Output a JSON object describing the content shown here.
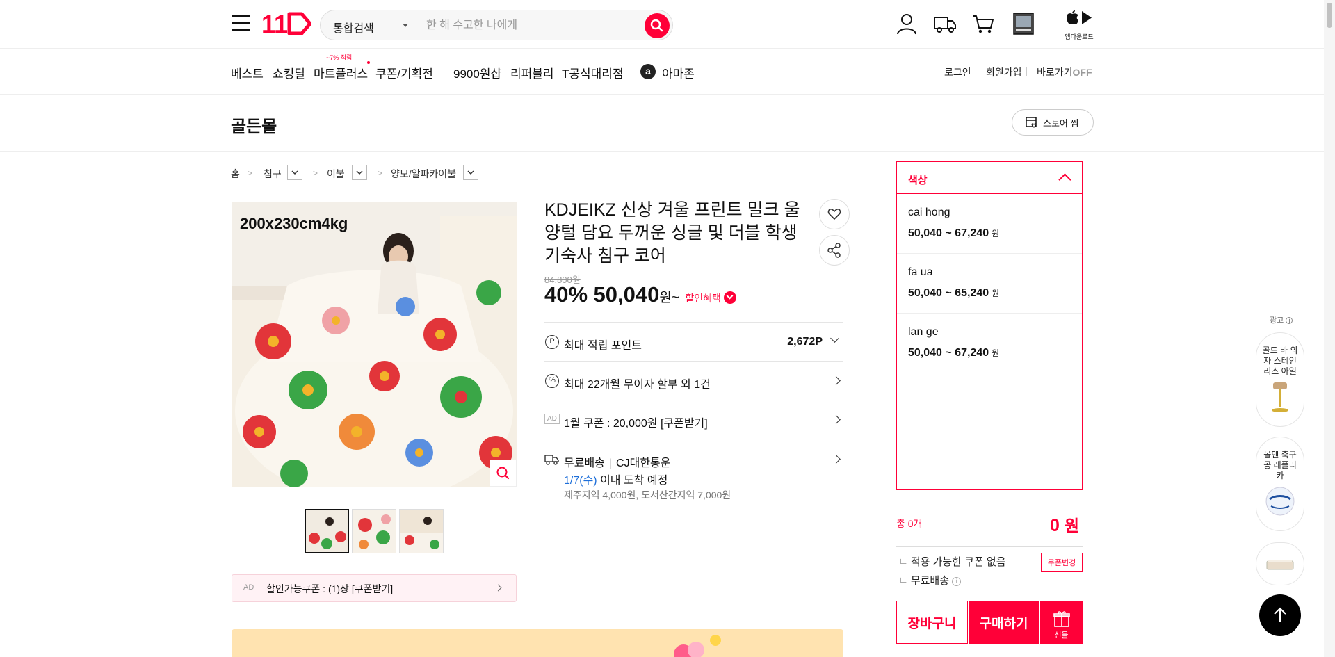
{
  "header": {
    "search_category": "통합검색",
    "search_placeholder": "한 해 수고한 나에게",
    "app_download_label": "앱다운로드",
    "icons": [
      "menu-icon",
      "user-icon",
      "delivery-truck-icon",
      "cart-icon",
      "recent-view-icon",
      "app-store-icon",
      "play-store-icon",
      "search-icon"
    ]
  },
  "nav": {
    "items": [
      "베스트",
      "쇼킹딜",
      "마트플러스",
      "쿠폰/기획전",
      "9900원샵",
      "리퍼블리",
      "T공식대리점",
      "아마존"
    ],
    "mart_badge": "~7% 적립",
    "util_links": [
      "로그인",
      "회원가입",
      "바로가기"
    ],
    "shortcut_state": "OFF"
  },
  "store": {
    "name": "골든몰",
    "fav_button": "스토어 찜"
  },
  "breadcrumb": [
    "홈",
    "침구",
    "이불",
    "양모/알파카이불"
  ],
  "product": {
    "image_text": "200x230cm4kg",
    "title": "KDJEIKZ 신상 겨울 프린트 밀크 울 양털 담요 두꺼운 싱글 및 더블 학생 기숙사 침구 코어",
    "original_price": "84,800원",
    "discount": "40%",
    "price": "50,040",
    "price_unit": "원~",
    "discount_benefit": "할인혜택",
    "points_label": "최대 적립 포인트",
    "points_value": "2,672P",
    "installment": "최대 22개월 무이자 할부 외 1건",
    "ad_tag": "AD",
    "monthly_coupon": "1월 쿠폰 : 20,000원 [쿠폰받기]",
    "shipping_free": "무료배송",
    "shipping_carrier": "CJ대한통운",
    "arrival_date": "1/7(수)",
    "arrival_text": "이내 도착 예정",
    "extra_fee": "제주지역 4,000원, 도서산간지역 7,000원",
    "coupon_banner": "할인가능쿠폰 : (1)장 [쿠폰받기]",
    "coupon_count": "1"
  },
  "options": {
    "title": "색상",
    "items": [
      {
        "name": "cai hong",
        "price": "50,040 ~ 67,240",
        "unit": "원"
      },
      {
        "name": "fa ua",
        "price": "50,040 ~ 65,240",
        "unit": "원"
      },
      {
        "name": "lan ge",
        "price": "50,040 ~ 67,240",
        "unit": "원"
      }
    ]
  },
  "order": {
    "total_label": "총 0개",
    "total_amount": "0",
    "total_unit": "원",
    "no_coupon": "적용 가능한 쿠폰 없음",
    "coupon_change": "쿠폰변경",
    "free_ship": "무료배송",
    "cart_button": "장바구니",
    "buy_button": "구매하기",
    "gift_button": "선물"
  },
  "side_ads": {
    "label": "광고",
    "items": [
      "골드 바 의자 스테인리스 아일",
      "몰텐 축구공 레플리카"
    ]
  },
  "colors": {
    "accent": "#ff0038",
    "link_blue": "#1e6fd9"
  }
}
